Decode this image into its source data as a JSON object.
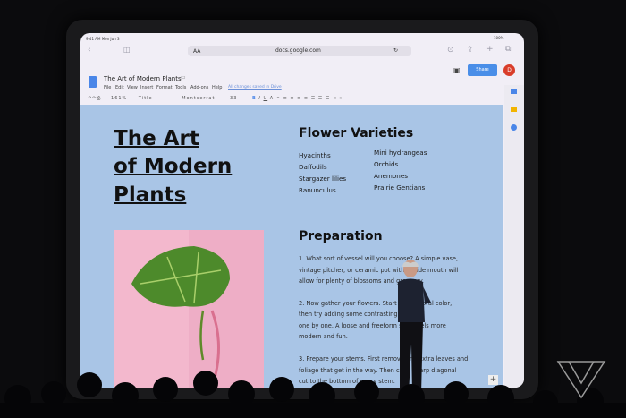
{
  "status": {
    "time": "9:41 AM  Mon Jun 3",
    "battery": "100%"
  },
  "browser": {
    "text_size": "AA",
    "url": "docs.google.com"
  },
  "doc": {
    "title": "The Art of Modern Plants",
    "menu": [
      "File",
      "Edit",
      "View",
      "Insert",
      "Format",
      "Tools",
      "Add-ons",
      "Help"
    ],
    "saved": "All changes saved in Drive",
    "share": "Share",
    "avatar": "D",
    "toolbar": {
      "zoom": "161%",
      "style": "Title",
      "font": "Montserrat",
      "size": "33"
    }
  },
  "content": {
    "heading": [
      "The Art",
      "of Modern",
      "Plants"
    ],
    "varieties_title": "Flower Varieties",
    "col1": [
      "Hyacinths",
      "Daffodils",
      "Stargazer lilies",
      "Ranunculus"
    ],
    "col2": [
      "Mini hydrangeas",
      "Orchids",
      "Anemones",
      "Prairie Gentians"
    ],
    "prep_title": "Preparation",
    "paras": [
      [
        "1. What sort of vessel will you choose? A simple vase,",
        "vintage pitcher, or ceramic pot with a wide mouth will",
        "allow for plenty of blossoms and greenery."
      ],
      [
        "2. Now gather your flowers. Start with a floral color,",
        "then try adding some contrasting colors",
        "one by one. A loose and freeform style feels more",
        "modern and fun."
      ],
      [
        "3. Prepare your stems. First remove any extra leaves and",
        "foliage that get in the way. Then cut a sharp diagonal",
        "cut to the bottom of every stem."
      ]
    ]
  }
}
